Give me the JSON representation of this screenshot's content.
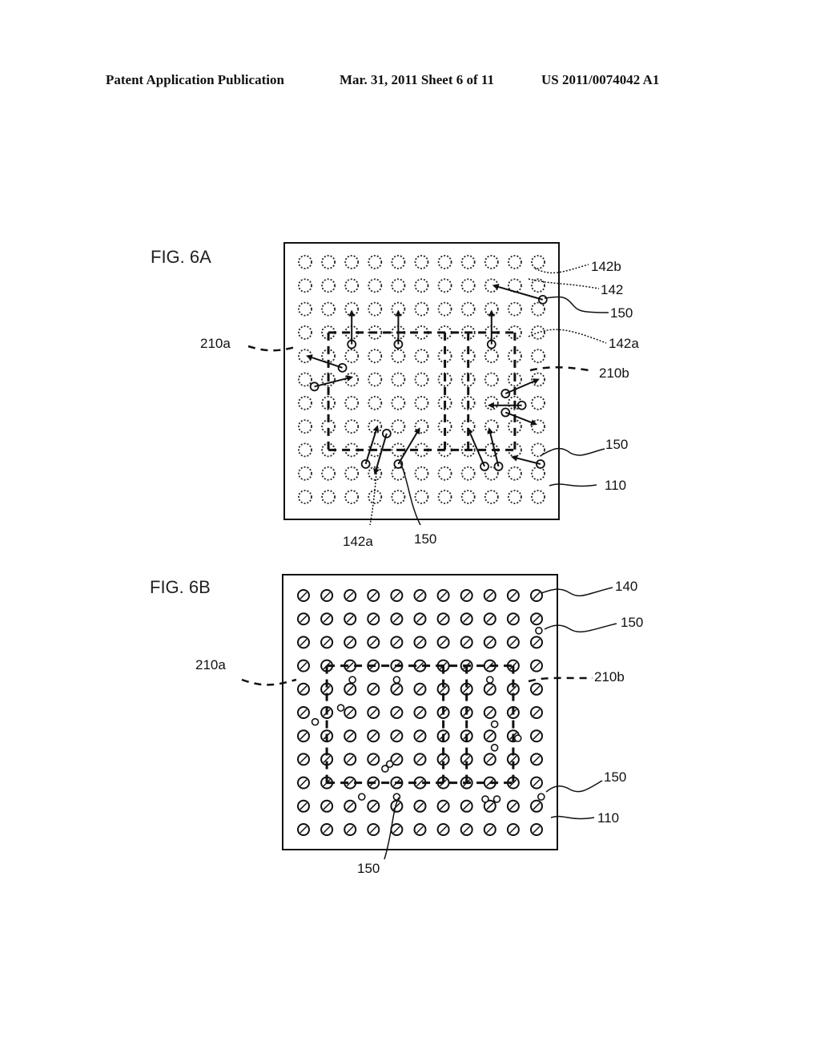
{
  "header": {
    "publication": "Patent Application Publication",
    "date_sheet": "Mar. 31, 2011  Sheet 6 of 11",
    "number": "US 2011/0074042 A1"
  },
  "figures": [
    {
      "id": "fig6a",
      "title": "FIG. 6A",
      "grid": {
        "rows": 11,
        "cols": 11,
        "dot_style": "dashed-circle"
      },
      "labels": {
        "r142b": "142b",
        "r142": "142",
        "r150_top": "150",
        "r142a_right": "142a",
        "r210b": "210b",
        "r150_right": "150",
        "r110": "110",
        "r210a": "210a",
        "r142a_bottom": "142a",
        "r150_bottom": "150"
      }
    },
    {
      "id": "fig6b",
      "title": "FIG. 6B",
      "grid": {
        "rows": 11,
        "cols": 11,
        "dot_style": "slashed-circle"
      },
      "labels": {
        "r140": "140",
        "r150_top": "150",
        "r210a": "210a",
        "r210b": "210b",
        "r150_right": "150",
        "r110": "110",
        "r150_bottom": "150"
      }
    }
  ]
}
